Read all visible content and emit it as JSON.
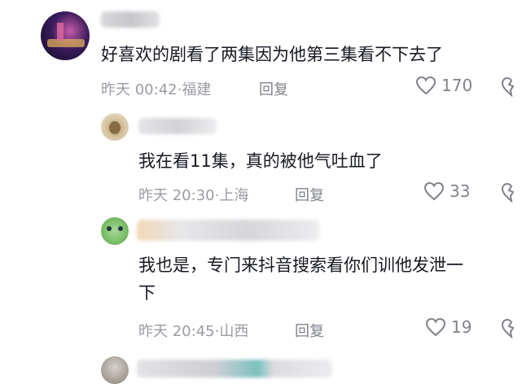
{
  "comments": [
    {
      "text": "好喜欢的剧看了两集因为他第三集看不下去了",
      "time": "昨天 00:42",
      "location": "福建",
      "reply_label": "回复",
      "likes": "170"
    },
    {
      "text": "我在看11集，真的被他气吐血了",
      "time": "昨天 20:30",
      "location": "上海",
      "reply_label": "回复",
      "likes": "33"
    },
    {
      "text_line1": "我也是，专门来抖音搜索看你们训他发泄一",
      "text_line2": "下",
      "time": "昨天 20:45",
      "location": "山西",
      "reply_label": "回复",
      "likes": "19"
    }
  ],
  "colors": {
    "text": "#161823",
    "meta": "#9a9ca3",
    "icon": "#7f828a"
  },
  "icons": [
    "heart-icon",
    "dislike-icon"
  ]
}
